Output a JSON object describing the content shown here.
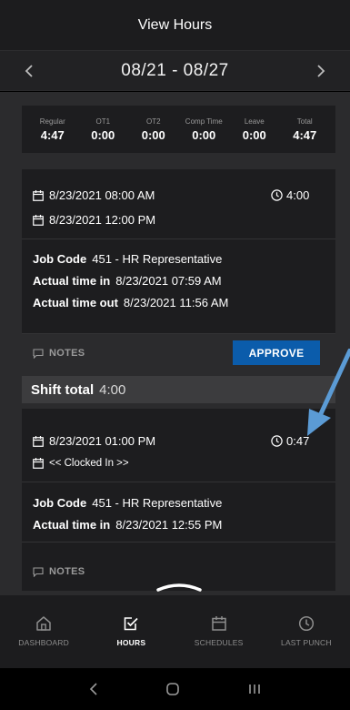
{
  "header": {
    "title": "View Hours"
  },
  "week_nav": {
    "range": "08/21 - 08/27"
  },
  "totals": [
    {
      "label": "Regular",
      "value": "4:47"
    },
    {
      "label": "OT1",
      "value": "0:00"
    },
    {
      "label": "OT2",
      "value": "0:00"
    },
    {
      "label": "Comp Time",
      "value": "0:00"
    },
    {
      "label": "Leave",
      "value": "0:00"
    },
    {
      "label": "Total",
      "value": "4:47"
    }
  ],
  "shifts": [
    {
      "start": "8/23/2021 08:00 AM",
      "end": "8/23/2021 12:00 PM",
      "duration": "4:00",
      "job_code_label": "Job Code",
      "job_code": "451 - HR Representative",
      "time_in_label": "Actual time in",
      "time_in": "8/23/2021 07:59 AM",
      "time_out_label": "Actual time out",
      "time_out": "8/23/2021 11:56 AM",
      "notes_label": "NOTES",
      "approve_label": "APPROVE",
      "shift_total_label": "Shift total",
      "shift_total": "4:00"
    },
    {
      "start": "8/23/2021 01:00 PM",
      "end": "<< Clocked In >>",
      "duration": "0:47",
      "job_code_label": "Job Code",
      "job_code": "451 - HR Representative",
      "time_in_label": "Actual time in",
      "time_in": "8/23/2021 12:55 PM",
      "notes_label": "NOTES"
    }
  ],
  "tabs": [
    {
      "label": "DASHBOARD",
      "icon": "home-icon",
      "active": false
    },
    {
      "label": "HOURS",
      "icon": "check-square-icon",
      "active": true
    },
    {
      "label": "SCHEDULES",
      "icon": "calendar-icon",
      "active": false
    },
    {
      "label": "LAST PUNCH",
      "icon": "clock-icon",
      "active": false
    }
  ],
  "colors": {
    "accent": "#0b5cab",
    "arrow": "#5b9bd5",
    "background": "#2b2b2d",
    "card": "#1d1d1f"
  }
}
